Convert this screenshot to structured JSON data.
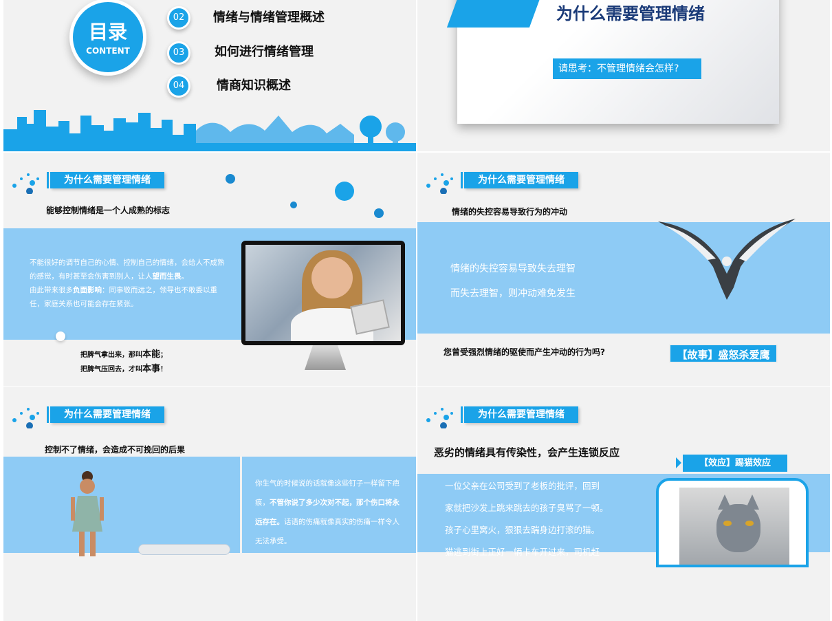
{
  "slide1": {
    "toc_title": "目录",
    "toc_subtitle": "CONTENT",
    "items": [
      {
        "num": "02",
        "text": "情绪与情绪管理概述"
      },
      {
        "num": "03",
        "text": "如何进行情绪管理"
      },
      {
        "num": "04",
        "text": "情商知识概述"
      }
    ]
  },
  "slide2": {
    "title": "为什么需要管理情绪",
    "prompt": "请思考：不管理情绪会怎样?"
  },
  "slide3": {
    "header": "为什么需要管理情绪",
    "subtitle": "能够控制情绪是一个人成熟的标志",
    "body_1a": "不能很好的调节自己的心情、控制自己的情绪，会给人不成熟的感觉，有时甚至会伤害到别人，让人",
    "body_1b": "望而生畏",
    "body_1c": "。",
    "body_2a": "由此带来很多",
    "body_2b": "负面影响",
    "body_2c": "：同事敬而远之，领导也不敢委以重任，家庭关系也可能会存在紧张。",
    "foot_1a": "把脾气拿出来，那叫",
    "foot_1b": "本能",
    "foot_1c": "；",
    "foot_2a": "把脾气压回去，才叫",
    "foot_2b": "本事",
    "foot_2c": "！"
  },
  "slide4": {
    "header": "为什么需要管理情绪",
    "subtitle": "情绪的失控容易导致行为的冲动",
    "line1": "情绪的失控容易导致失去理智",
    "line2": "而失去理智，则冲动难免发生",
    "question": "您曾受强烈情绪的驱使而产生冲动的行为吗?",
    "story": "【故事】盛怒杀爱鹰"
  },
  "slide5": {
    "header": "为什么需要管理情绪",
    "subtitle": "控制不了情绪，会造成不可挽回的后果",
    "body_a": "你生气的时候说的话就像这些钉子一样留下疤痕，",
    "body_b": "不管你说了多少次对不起，那个伤口将永远存在。",
    "body_c": "话语的伤痛就像真实的伤痛一样令人无法承受。"
  },
  "slide6": {
    "header": "为什么需要管理情绪",
    "subtitle": "恶劣的情绪具有传染性，会产生连锁反应",
    "effect": "【效应】踢猫效应",
    "lines": [
      "一位父亲在公司受到了老板的批评，回到",
      "家就把沙发上跳来跳去的孩子臭骂了一顿。",
      "孩子心里窝火，狠狠去踹身边打滚的猫。",
      "猫逃到街上正好一辆卡车开过来，司机赶"
    ]
  },
  "colors": {
    "accent": "#1aa3e8",
    "band": "#8ecbf5",
    "title_navy": "#1a3a78"
  }
}
